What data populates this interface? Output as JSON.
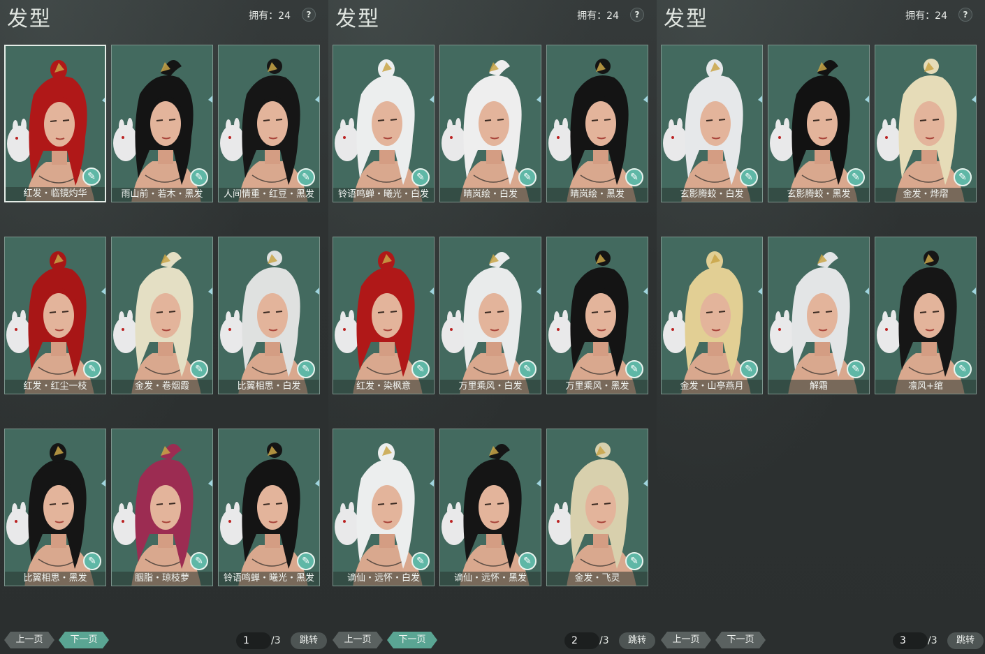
{
  "accent": "#5aa593",
  "panels": [
    {
      "title": "发型",
      "owned": "拥有：24",
      "help": "?",
      "cards": [
        {
          "label": "红发・临镜灼华",
          "hair": "#b01818",
          "selected": true
        },
        {
          "label": "雨山前・若木・黑发",
          "hair": "#141414"
        },
        {
          "label": "人间情重・红豆・黑发",
          "hair": "#161616"
        },
        {
          "label": "红发・红尘一枝",
          "hair": "#a81616"
        },
        {
          "label": "金发・卷烟霞",
          "hair": "#e4dfc4"
        },
        {
          "label": "比翼相思・白发",
          "hair": "#dfe1e0"
        },
        {
          "label": "比翼相思・黑发",
          "hair": "#151515"
        },
        {
          "label": "胭脂・琼枝萝",
          "hair": "#9c2c52"
        },
        {
          "label": "铃语鸣蝉・曦光・黑发",
          "hair": "#141414"
        }
      ],
      "pager": {
        "prev": "上一页",
        "next": "下一页",
        "page": "1",
        "total": "/3",
        "jump": "跳转"
      }
    },
    {
      "title": "发型",
      "owned": "拥有：24",
      "help": "?",
      "cards": [
        {
          "label": "铃语鸣蝉・曦光・白发",
          "hair": "#eceeee"
        },
        {
          "label": "晴岚绘・白发",
          "hair": "#eeeeee"
        },
        {
          "label": "晴岚绘・黑发",
          "hair": "#141414"
        },
        {
          "label": "红发・染枫意",
          "hair": "#b01818"
        },
        {
          "label": "万里乘风・白发",
          "hair": "#e9ebeb"
        },
        {
          "label": "万里乘风・黑发",
          "hair": "#141414"
        },
        {
          "label": "谪仙・远怀・白发",
          "hair": "#eceeee"
        },
        {
          "label": "谪仙・远怀・黑发",
          "hair": "#151515"
        },
        {
          "label": "金发・飞灵",
          "hair": "#d8d0ad"
        }
      ],
      "pager": {
        "prev": "上一页",
        "next": "下一页",
        "page": "2",
        "total": "/3",
        "jump": "跳转"
      }
    },
    {
      "title": "发型",
      "owned": "拥有：24",
      "help": "?",
      "cards": [
        {
          "label": "玄影腾蛟・白发",
          "hair": "#e6e8ea"
        },
        {
          "label": "玄影腾蛟・黑发",
          "hair": "#121212"
        },
        {
          "label": "金发・烨熠",
          "hair": "#e6dcb8"
        },
        {
          "label": "金发・山亭燕月",
          "hair": "#e2cf94"
        },
        {
          "label": "解霜",
          "hair": "#e3e5e6"
        },
        {
          "label": "凛风+绾",
          "hair": "#161616"
        }
      ],
      "pager": {
        "prev": "上一页",
        "next": "下一页",
        "page": "3",
        "total": "/3",
        "jump": "跳转"
      }
    }
  ]
}
